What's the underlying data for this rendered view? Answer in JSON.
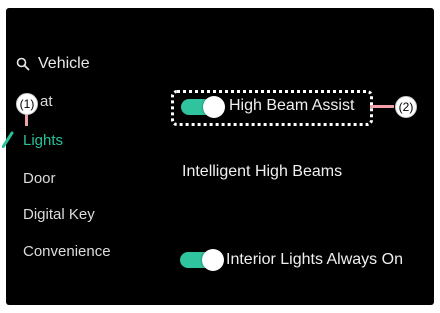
{
  "search": {
    "label": "Vehicle",
    "icon": "search-icon"
  },
  "sidebar": {
    "items": [
      {
        "label": "Seat",
        "label_visible": "at"
      },
      {
        "label": "Lights",
        "active": true
      },
      {
        "label": "Door"
      },
      {
        "label": "Digital Key"
      },
      {
        "label": "Convenience"
      }
    ]
  },
  "settings": {
    "high_beam_assist": {
      "label": "High Beam Assist",
      "enabled": true
    },
    "intelligent_high_beams": {
      "label": "Intelligent High Beams"
    },
    "interior_lights": {
      "label": "Interior Lights Always On",
      "enabled": true
    }
  },
  "callouts": {
    "one": "(1)",
    "two": "(2)"
  },
  "colors": {
    "accent": "#26c39a",
    "toggle_on": "#2fc49d",
    "background": "#000000",
    "text": "#f0f0f0",
    "callout_line": "#f0a0a8"
  }
}
